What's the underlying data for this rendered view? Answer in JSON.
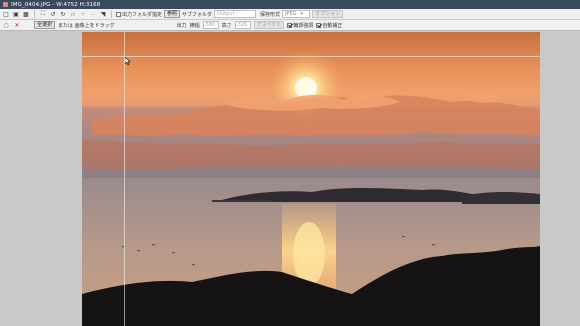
{
  "window": {
    "title": "IMG_0404.JPG - W:4752 H:3168"
  },
  "toolbar_top": {
    "output_folder_label": "出力フォルダ指定",
    "browse_button": "参照",
    "subfolder_label": "サブフォルダ",
    "subfolder_placeholder": "Output",
    "save_format_label": "保存形式",
    "save_format_value": "JPEG",
    "options_button": "オプション"
  },
  "toolbar_bottom": {
    "select_all_button": "全選択",
    "drag_hint": "または 画像上をドラッグ",
    "output_label": "出力",
    "width_label": "横幅",
    "width_value": "580",
    "height_label": "高さ",
    "height_value": "326",
    "aspect_button": "アスペクト",
    "clear_sharpen_label": "輪郭強調",
    "auto_correct_label": "自動補正"
  },
  "icons": {
    "ok": "circle-icon",
    "cancel": "x-icon"
  }
}
